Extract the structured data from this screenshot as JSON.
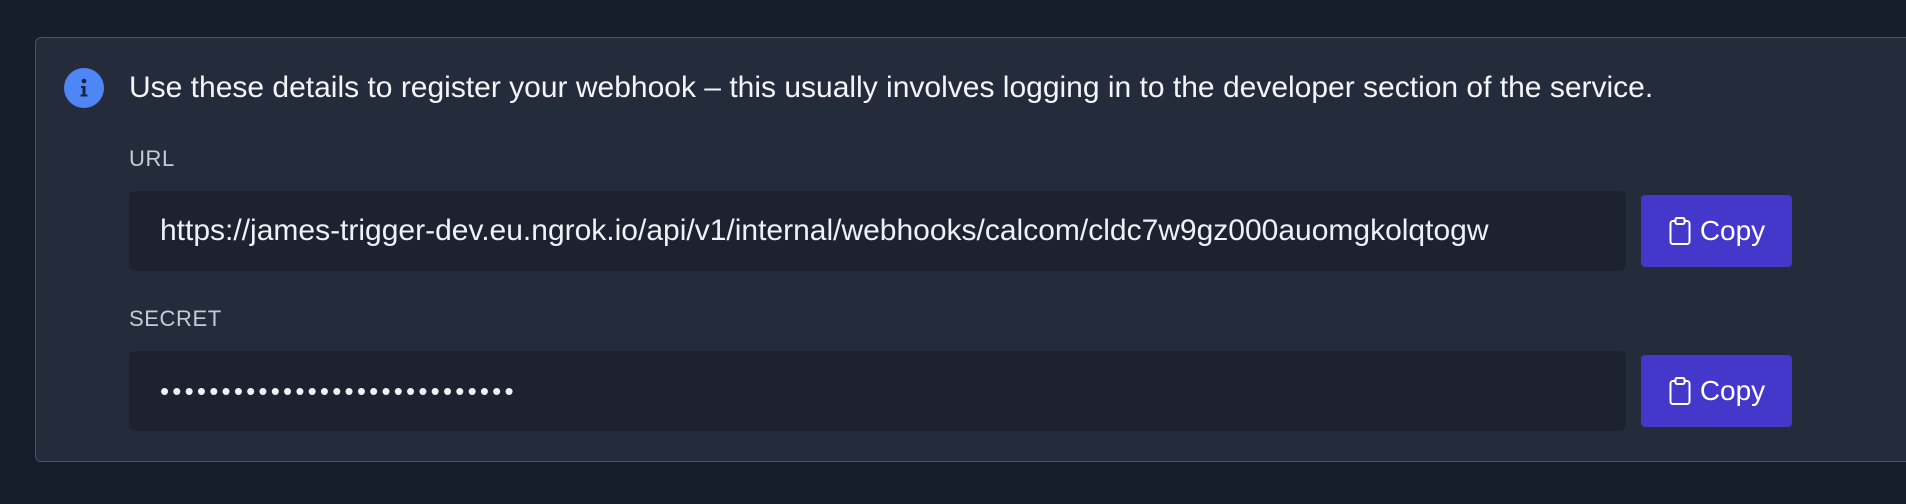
{
  "info": {
    "icon": "info-icon",
    "message": "Use these details to register your webhook – this usually involves logging in to the developer section of the service."
  },
  "url_field": {
    "label": "URL",
    "value": "https://james-trigger-dev.eu.ngrok.io/api/v1/internal/webhooks/calcom/cldc7w9gz000auomgkolqtogw"
  },
  "secret_field": {
    "label": "SECRET",
    "value": "•••••••••••••••••••••••••••••"
  },
  "buttons": {
    "copy_label": "Copy",
    "icon": "clipboard-icon"
  },
  "colors": {
    "background": "#161d2b",
    "panel": "#242c3c",
    "field": "#1c2230",
    "accent_button": "#4338ca",
    "info_icon": "#4f86f5"
  }
}
